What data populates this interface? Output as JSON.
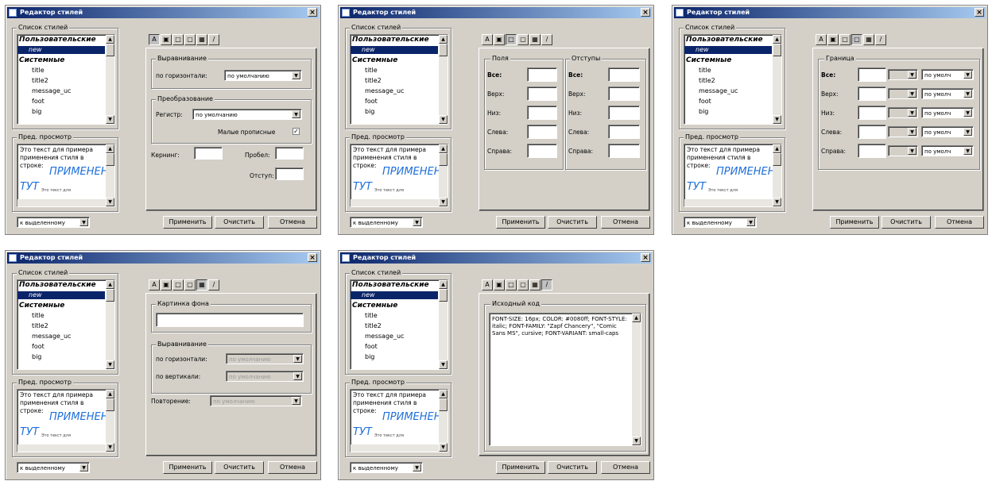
{
  "title": "Редактор стилей",
  "styles_list": {
    "label": "Список стилей",
    "items": [
      {
        "text": "Пользовательские",
        "kind": "hdr"
      },
      {
        "text": "new",
        "kind": "sel"
      },
      {
        "text": "Системные",
        "kind": "hdr"
      },
      {
        "text": "title",
        "kind": "item"
      },
      {
        "text": "title2",
        "kind": "item"
      },
      {
        "text": "message_uc",
        "kind": "item"
      },
      {
        "text": "foot",
        "kind": "item"
      },
      {
        "text": "big",
        "kind": "item"
      }
    ]
  },
  "preview": {
    "label": "Пред. просмотр",
    "text": "Это текст для примера применения стиля в строке:",
    "big_line1": "ПРИМЕНЕН",
    "big_line2": "ТУТ",
    "small": "Это текст для"
  },
  "apply_to": "к выделенному",
  "buttons": {
    "apply": "Применить",
    "clear": "Очистить",
    "cancel": "Отмена"
  },
  "tabs": [
    "A",
    "▣",
    "□",
    "▢",
    "▦",
    "/"
  ],
  "text_tab": {
    "align_group": "Выравнивание",
    "horiz_label": "по горизонтали:",
    "horiz_value": "по умолчанию",
    "transform_group": "Преобразование",
    "case_label": "Регистр:",
    "case_value": "по умолчанию",
    "smallcaps_label": "Малые прописные",
    "kerning_label": "Кернинг:",
    "spacing_label": "Пробел:",
    "indent_label": "Отступ:"
  },
  "box_tab": {
    "fields_group": "Поля",
    "offsets_group": "Отступы",
    "rows": [
      "Все:",
      "Верх:",
      "Низ:",
      "Слева:",
      "Справа:"
    ]
  },
  "border_tab": {
    "group": "Граница",
    "rows": [
      "Все:",
      "Верх:",
      "Низ:",
      "Слева:",
      "Справа:"
    ],
    "style_value": "по умолч"
  },
  "bg_tab": {
    "image_group": "Картинка фона",
    "align_group": "Выравнивание",
    "horiz_label": "по горизонтали:",
    "vert_label": "по вертикали:",
    "repeat_label": "Повторение:",
    "default_value": "по умолчанию"
  },
  "source_tab": {
    "group": "Исходный код",
    "code": "FONT-SIZE: 16px; COLOR: #0080ff; FONT-STYLE: italic; FONT-FAMILY: \"Zapf Chancery\", \"Comic Sans MS\", cursive; FONT-VARIANT: small-caps"
  }
}
